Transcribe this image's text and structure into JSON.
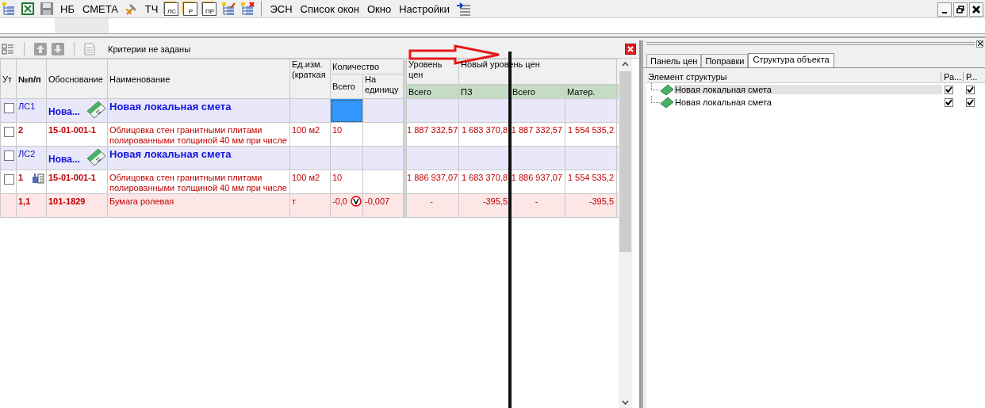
{
  "toolbar": [
    {
      "kind": "tree"
    },
    {
      "kind": "excel"
    },
    {
      "kind": "save"
    },
    {
      "kind": "text",
      "label": "НБ"
    },
    {
      "kind": "text",
      "label": "СМЕТА"
    },
    {
      "kind": "hammer"
    },
    {
      "kind": "text",
      "label": "ТЧ"
    },
    {
      "kind": "badge",
      "label": "ЛС"
    },
    {
      "kind": "badge",
      "label": "Р"
    },
    {
      "kind": "badge",
      "label": "ПР"
    },
    {
      "kind": "tree-edit"
    },
    {
      "kind": "tree-delete"
    },
    {
      "kind": "separator"
    },
    {
      "kind": "text",
      "label": "ЭСН"
    },
    {
      "kind": "text",
      "label": "Список окон"
    },
    {
      "kind": "text",
      "label": "Окно"
    },
    {
      "kind": "text",
      "label": "Настройки"
    },
    {
      "kind": "indent"
    }
  ],
  "panel": {
    "criteria": "Критерии не заданы"
  },
  "table": {
    "header": {
      "ut": "Ут",
      "num": "№п/п",
      "basis": "Обоснование",
      "name": "Наименование",
      "unit": "Ед.изм. (краткая",
      "qty": "Количество",
      "qty_total": "Всего",
      "qty_unit": "На единицу",
      "price_level": "Уровень цен",
      "new_price_level": "Новый уровень цен",
      "sub": [
        "Всего",
        "ПЗ",
        "Всего",
        "Матер."
      ]
    },
    "rows": [
      {
        "kind": "group",
        "checked": false,
        "num": "ЛС1",
        "basis": "Нова...",
        "name": "Новая локальная смета",
        "qty_selected": true
      },
      {
        "kind": "item",
        "checked": false,
        "num": "2",
        "basis": "15-01-001-1",
        "name": "Облицовка стен гранитными плитами полированными толщиной 40 мм при числе",
        "unit": "100 м2",
        "qty_total": "10",
        "values": [
          "1 887 332,57",
          "1 683 370,8",
          "1 887 332,57",
          "1 554 535,2"
        ],
        "qty_selected": false
      },
      {
        "kind": "group",
        "checked": false,
        "num": "ЛС2",
        "basis": "Нова...",
        "name": "Новая локальная смета",
        "qty_selected": false
      },
      {
        "kind": "item",
        "checked": false,
        "num": "1",
        "linked": true,
        "basis": "15-01-001-1",
        "name": "Облицовка стен гранитными плитами полированными толщиной 40 мм при числе",
        "unit": "100 м2",
        "qty_total": "10",
        "values": [
          "1 886 937,07",
          "1 683 370,8",
          "1 886 937,07",
          "1 554 535,2"
        ],
        "qty_selected": false
      },
      {
        "kind": "resource",
        "num": "1,1",
        "basis": "101-1829",
        "name": "Бумага ролевая",
        "unit": "т",
        "qty_total": "-0,0",
        "warning": true,
        "qty_unit": "-0,007",
        "values": [
          "-",
          "-395,5",
          "-",
          "-395,5"
        ],
        "qty_selected": false
      }
    ]
  },
  "side": {
    "tabs": [
      {
        "label": "Панель цен",
        "selected": false
      },
      {
        "label": "Поправки",
        "selected": false
      },
      {
        "label": "Структура объекта",
        "selected": true
      }
    ],
    "columns": [
      "Элемент структуры",
      "Ра...",
      "Р..."
    ],
    "rows": [
      {
        "label": "Новая локальная смета",
        "selected": true,
        "flags": [
          true,
          true
        ]
      },
      {
        "label": "Новая локальная смета",
        "selected": false,
        "flags": [
          true,
          true
        ]
      }
    ]
  }
}
